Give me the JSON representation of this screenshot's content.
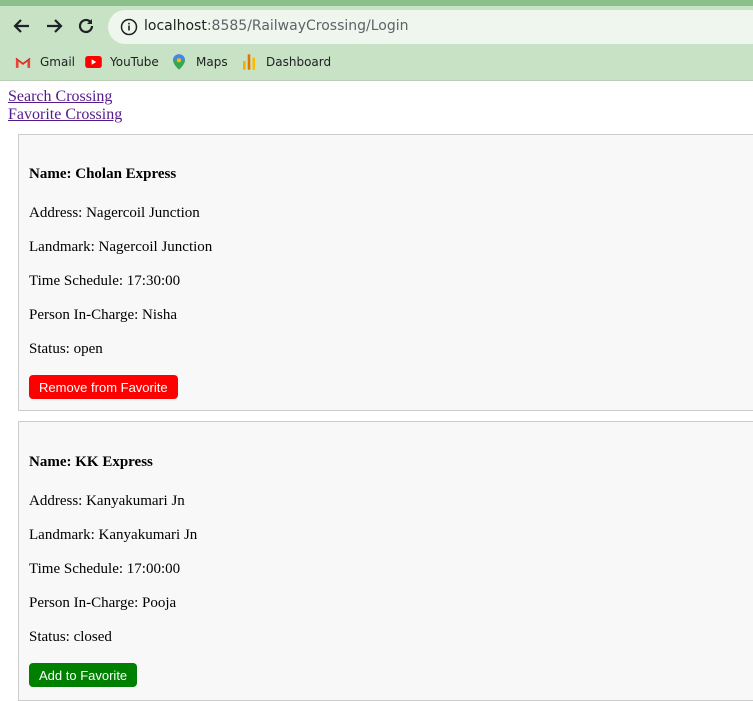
{
  "browser": {
    "url_host": "localhost",
    "url_path": ":8585/RailwayCrossing/Login",
    "bookmarks": [
      {
        "label": "Gmail"
      },
      {
        "label": "YouTube"
      },
      {
        "label": "Maps"
      },
      {
        "label": "Dashboard"
      }
    ]
  },
  "nav": {
    "search_link": "Search Crossing",
    "favorite_link": "Favorite Crossing"
  },
  "crossings": [
    {
      "name": "Name: Cholan Express",
      "address": "Address: Nagercoil Junction",
      "landmark": "Landmark: Nagercoil Junction",
      "schedule": "Time Schedule: 17:30:00",
      "person": "Person In-Charge: Nisha",
      "status": "Status: open",
      "button_label": "Remove from Favorite",
      "button_color": "#ff0000"
    },
    {
      "name": "Name: KK Express",
      "address": "Address: Kanyakumari Jn",
      "landmark": "Landmark: Kanyakumari Jn",
      "schedule": "Time Schedule: 17:00:00",
      "person": "Person In-Charge: Pooja",
      "status": "Status: closed",
      "button_label": "Add to Favorite",
      "button_color": "#008000"
    }
  ]
}
